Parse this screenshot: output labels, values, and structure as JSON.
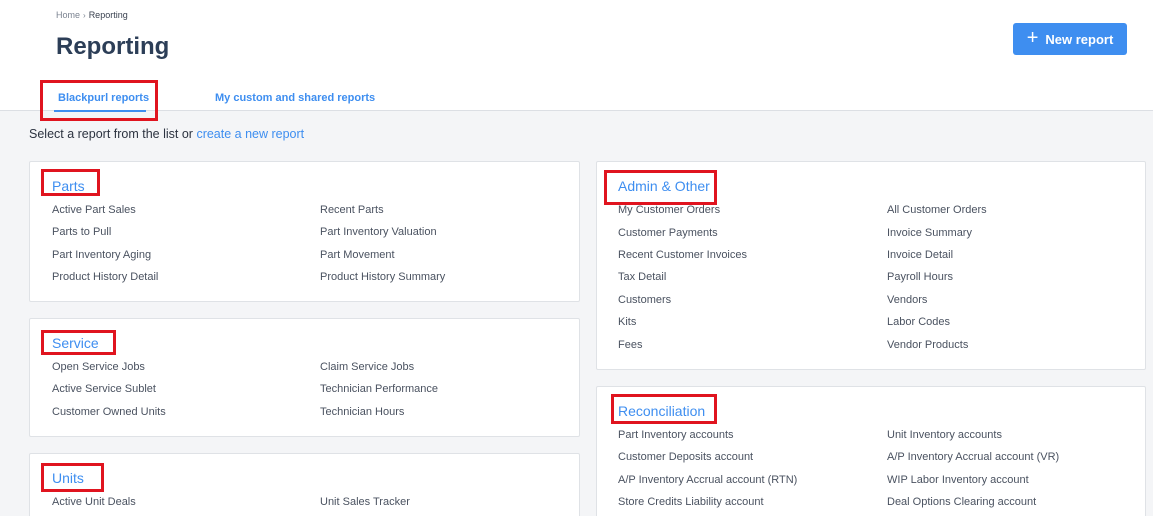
{
  "breadcrumb": {
    "home": "Home",
    "current": "Reporting"
  },
  "page_title": "Reporting",
  "new_report_label": "New report",
  "tabs": {
    "blackpurl": "Blackpurl reports",
    "custom": "My custom and shared reports"
  },
  "instructions": {
    "prefix": "Select a report from the list or",
    "link": "create a new report"
  },
  "parts": {
    "title": "Parts",
    "items": [
      "Active Part Sales",
      "Recent Parts",
      "Parts to Pull",
      "Part Inventory Valuation",
      "Part Inventory Aging",
      "Part Movement",
      "Product History Detail",
      "Product History Summary"
    ]
  },
  "service": {
    "title": "Service",
    "items": [
      "Open Service Jobs",
      "Claim Service Jobs",
      "Active Service Sublet",
      "Technician Performance",
      "Customer Owned Units",
      "Technician Hours"
    ]
  },
  "units": {
    "title": "Units",
    "items": [
      "Active Unit Deals",
      "Unit Sales Tracker"
    ]
  },
  "admin": {
    "title": "Admin & Other",
    "items": [
      "My Customer Orders",
      "All Customer Orders",
      "Customer Payments",
      "Invoice Summary",
      "Recent Customer Invoices",
      "Invoice Detail",
      "Tax Detail",
      "Payroll Hours",
      "Customers",
      "Vendors",
      "Kits",
      "Labor Codes",
      "Fees",
      "Vendor Products"
    ]
  },
  "reconciliation": {
    "title": "Reconciliation",
    "items": [
      "Part Inventory accounts",
      "Unit Inventory accounts",
      "Customer Deposits account",
      "A/P Inventory Accrual account (VR)",
      "A/P Inventory Accrual account (RTN)",
      "WIP Labor Inventory account",
      "Store Credits Liability account",
      "Deal Options Clearing account"
    ]
  },
  "colors": {
    "accent": "#3e8ef0",
    "highlight": "#e0141f",
    "title": "#2c3e57"
  }
}
